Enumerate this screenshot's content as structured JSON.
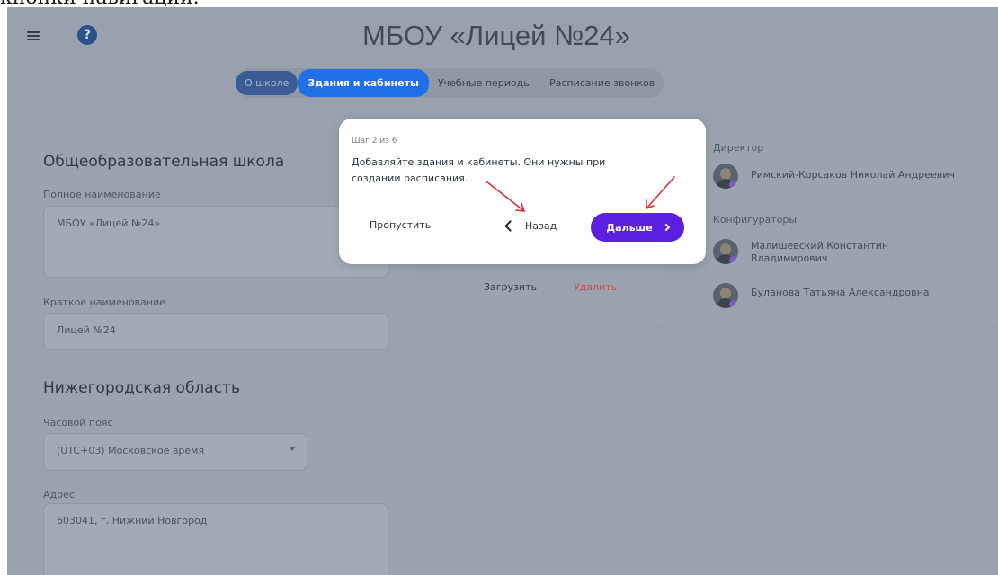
{
  "caption": "кнопки навигации.",
  "header": {
    "title": "МБОУ «Лицей №24»",
    "menu_icon": "hamburger-menu-icon",
    "help_icon": "question-circle-icon",
    "help_glyph": "?"
  },
  "tabs": [
    {
      "label": "О школе"
    },
    {
      "label": "Здания и кабинеты"
    },
    {
      "label": "Учебные периоды"
    },
    {
      "label": "Расписание звонков"
    }
  ],
  "school_card": {
    "heading": "Общеобразовательная школа",
    "full_name_label": "Полное наименование",
    "full_name_value": "МБОУ «Лицей №24»",
    "short_name_label": "Краткое наименование",
    "short_name_value": "Лицей №24",
    "region_heading": "Нижегородская область",
    "timezone_label": "Часовой пояс",
    "timezone_value": "(UTC+03) Московское время",
    "address_label": "Адрес",
    "address_value": "603041, г. Нижний Новгород"
  },
  "logo_card": {
    "upload_label": "Загрузить",
    "delete_label": "Удалить"
  },
  "staff_card": {
    "director_label": "Директор",
    "director_name": "Римский-Корсаков Николай Андреевич",
    "configurators_label": "Конфигураторы",
    "configurators": [
      {
        "name_line1": "Малишевский Константин",
        "name_line2": "Владимирович"
      },
      {
        "name_line1": "Буланова Татьяна Александровна",
        "name_line2": ""
      }
    ]
  },
  "tour_popup": {
    "step_text": "Шаг 2 из 6",
    "message_line1": "Добавляйте здания и кабинеты. Они нужны при",
    "message_line2": "создании расписания.",
    "skip_label": "Пропустить",
    "back_label": "Назад",
    "next_label": "Дальше"
  },
  "colors": {
    "overlay": "#98a1ad",
    "accent_tab": "#1f6fe6",
    "next_button": "#5b1fe0",
    "annotation_arrow": "#e0292f",
    "delete_text": "#c4505a"
  }
}
